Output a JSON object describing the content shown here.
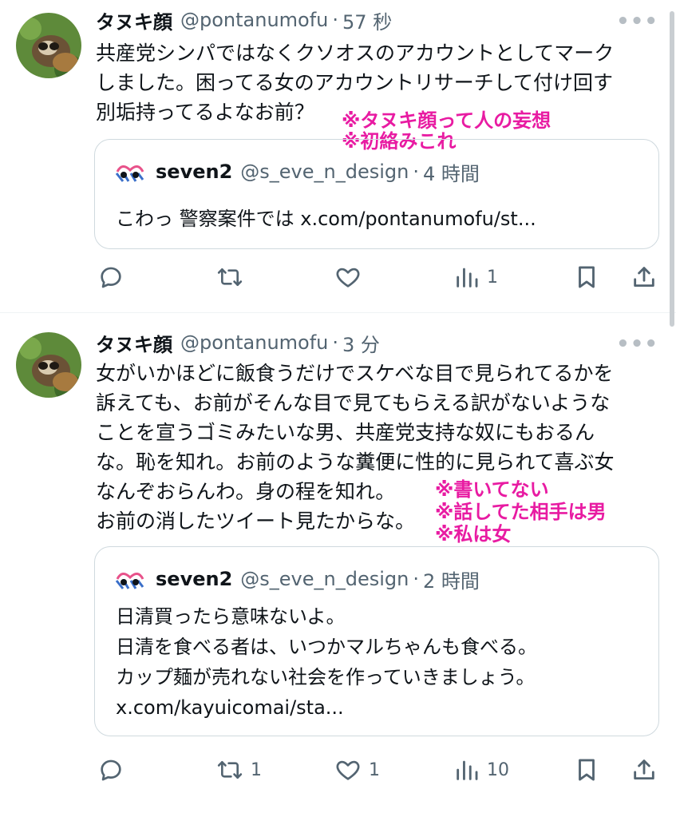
{
  "tweets": [
    {
      "author_name": "タヌキ顔",
      "handle": "@pontanumofu",
      "separator": "·",
      "time": "57 秒",
      "more": "•••",
      "text_lines": [
        "共産党シンパではなくクソオスのアカウントとしてマーク",
        "しました。困ってる女のアカウントリサーチして付け回す",
        "別垢持ってるよなお前？"
      ],
      "annotations": [
        "※タヌキ顔って人の妄想",
        "※初絡みこれ"
      ],
      "quote": {
        "author_name": "seven2",
        "handle": "@s_eve_n_design",
        "separator": "·",
        "time": "4 時間",
        "text_lines": [
          "こわっ 警察案件では x.com/pontanumofu/st..."
        ]
      },
      "actions": {
        "reply": "",
        "retweet": "",
        "like": "",
        "views": "1"
      }
    },
    {
      "author_name": "タヌキ顔",
      "handle": "@pontanumofu",
      "separator": "·",
      "time": "3 分",
      "more": "•••",
      "text_lines": [
        "女がいかほどに飯食うだけでスケベな目で見られてるかを",
        "訴えても、お前がそんな目で見てもらえる訳がないような",
        "ことを宣うゴミみたいな男、共産党支持な奴にもおるん",
        "な。恥を知れ。お前のような糞便に性的に見られて喜ぶ女",
        "なんぞおらんわ。身の程を知れ。",
        "お前の消したツイート見たからな。"
      ],
      "annotations": [
        "※書いてない",
        "※話してた相手は男",
        "※私は女"
      ],
      "quote": {
        "author_name": "seven2",
        "handle": "@s_eve_n_design",
        "separator": "·",
        "time": "2 時間",
        "text_lines": [
          "日清買ったら意味ないよ。",
          "日清を食べる者は、いつかマルちゃんも食べる。",
          "カップ麺が売れない社会を作っていきましょう。",
          "x.com/kayuicomai/sta..."
        ]
      },
      "actions": {
        "reply": "",
        "retweet": "1",
        "like": "1",
        "views": "10"
      }
    }
  ],
  "colors": {
    "text": "#0f1419",
    "muted": "#536471",
    "annotation": "#e81ba2",
    "border": "#cfd9de"
  },
  "icons": [
    "reply-icon",
    "retweet-icon",
    "like-icon",
    "views-icon",
    "bookmark-icon",
    "share-icon",
    "more-icon"
  ]
}
